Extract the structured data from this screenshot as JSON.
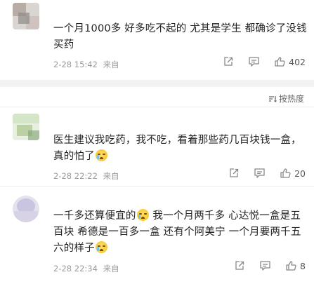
{
  "comments": [
    {
      "text": "一个月1000多 好多吃不起的 尤其是学生 都确诊了没钱买药",
      "time": "2-28 15:42",
      "source_prefix": "来自",
      "likes": "402"
    },
    {
      "text_parts": [
        "医生建议我吃药，我不吃，看着那些药几百块钱一盒，真的怕了",
        ""
      ],
      "time": "2-28 22:22",
      "source_prefix": "来自",
      "likes": "20"
    },
    {
      "text_parts": [
        "一千多还算便宜的",
        " 我一个月两千多 心达悦一盒是五百块 希德是一百多一盒 还有个阿美宁 一个月要两千五六的样子",
        ""
      ],
      "time": "2-28 22:34",
      "source_prefix": "来自",
      "likes": "8"
    }
  ],
  "sort": {
    "label": "按热度"
  },
  "icons": {
    "repost": "share-icon",
    "comment": "comment-icon",
    "like": "thumbs-up-icon",
    "sort": "sort-icon",
    "emoji": "crying-face-emoji"
  },
  "colors": {
    "text": "#222222",
    "meta": "#9a9a9a",
    "divider": "#f2f2f2"
  }
}
